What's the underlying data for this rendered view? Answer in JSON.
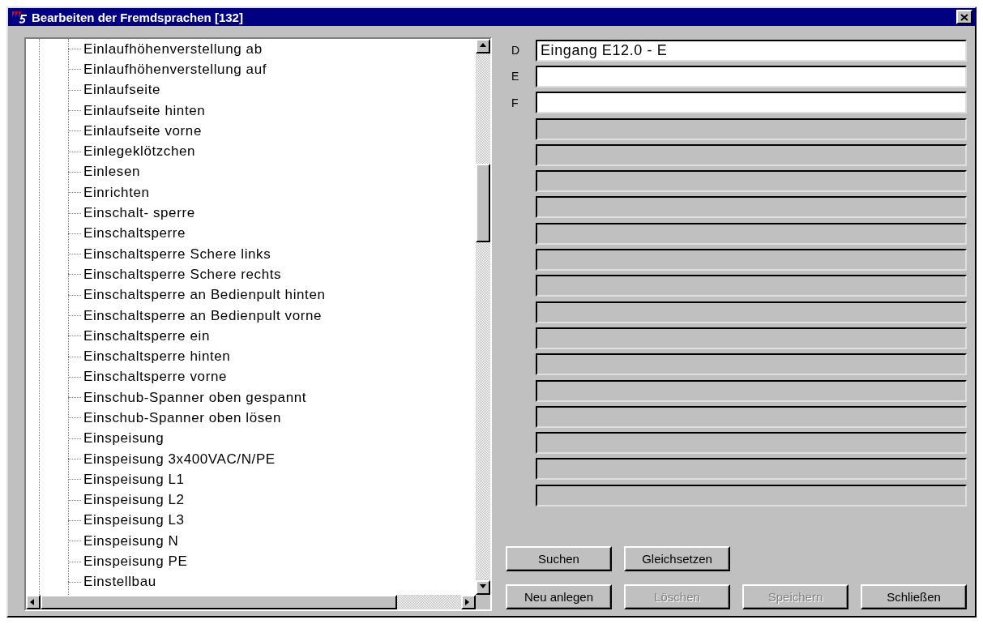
{
  "window": {
    "title": "Bearbeiten der Fremdsprachen [132]"
  },
  "tree": {
    "items": [
      {
        "label": "Einlaufhöhenverstellung ab"
      },
      {
        "label": "Einlaufhöhenverstellung auf"
      },
      {
        "label": "Einlaufseite"
      },
      {
        "label": "Einlaufseite hinten"
      },
      {
        "label": "Einlaufseite vorne"
      },
      {
        "label": "Einlegeklötzchen"
      },
      {
        "label": "Einlesen"
      },
      {
        "label": "Einrichten"
      },
      {
        "label": "Einschalt-  sperre"
      },
      {
        "label": "Einschaltsperre"
      },
      {
        "label": "Einschaltsperre Schere links"
      },
      {
        "label": "Einschaltsperre Schere rechts"
      },
      {
        "label": "Einschaltsperre an Bedienpult hinten"
      },
      {
        "label": "Einschaltsperre an Bedienpult vorne"
      },
      {
        "label": "Einschaltsperre ein"
      },
      {
        "label": "Einschaltsperre hinten"
      },
      {
        "label": "Einschaltsperre vorne"
      },
      {
        "label": "Einschub-Spanner oben gespannt"
      },
      {
        "label": "Einschub-Spanner oben lösen"
      },
      {
        "label": "Einspeisung"
      },
      {
        "label": "Einspeisung 3x400VAC/N/PE"
      },
      {
        "label": "Einspeisung L1"
      },
      {
        "label": "Einspeisung L2"
      },
      {
        "label": "Einspeisung L3"
      },
      {
        "label": "Einspeisung N"
      },
      {
        "label": "Einspeisung PE"
      },
      {
        "label": "Einstellbau"
      }
    ]
  },
  "fields": [
    {
      "label": "D",
      "value": "Eingang E12.0 - E",
      "disabled": false
    },
    {
      "label": "E",
      "disabled": false
    },
    {
      "label": "F",
      "disabled": false
    },
    {
      "disabled": true
    },
    {
      "disabled": true
    },
    {
      "disabled": true
    },
    {
      "disabled": true
    },
    {
      "disabled": true
    },
    {
      "disabled": true
    },
    {
      "disabled": true
    },
    {
      "disabled": true
    },
    {
      "disabled": true
    },
    {
      "disabled": true
    },
    {
      "disabled": true
    },
    {
      "disabled": true
    },
    {
      "disabled": true
    },
    {
      "disabled": true
    },
    {
      "disabled": true
    }
  ],
  "buttons": [
    [
      {
        "label": "Suchen",
        "disabled": false
      },
      {
        "label": "Gleichsetzen",
        "disabled": false
      }
    ],
    [
      {
        "label": "Neu anlegen",
        "disabled": false
      },
      {
        "label": "Löschen",
        "disabled": true
      },
      {
        "label": "Speichern",
        "disabled": true
      },
      {
        "label": "Schließen",
        "disabled": false
      }
    ]
  ]
}
